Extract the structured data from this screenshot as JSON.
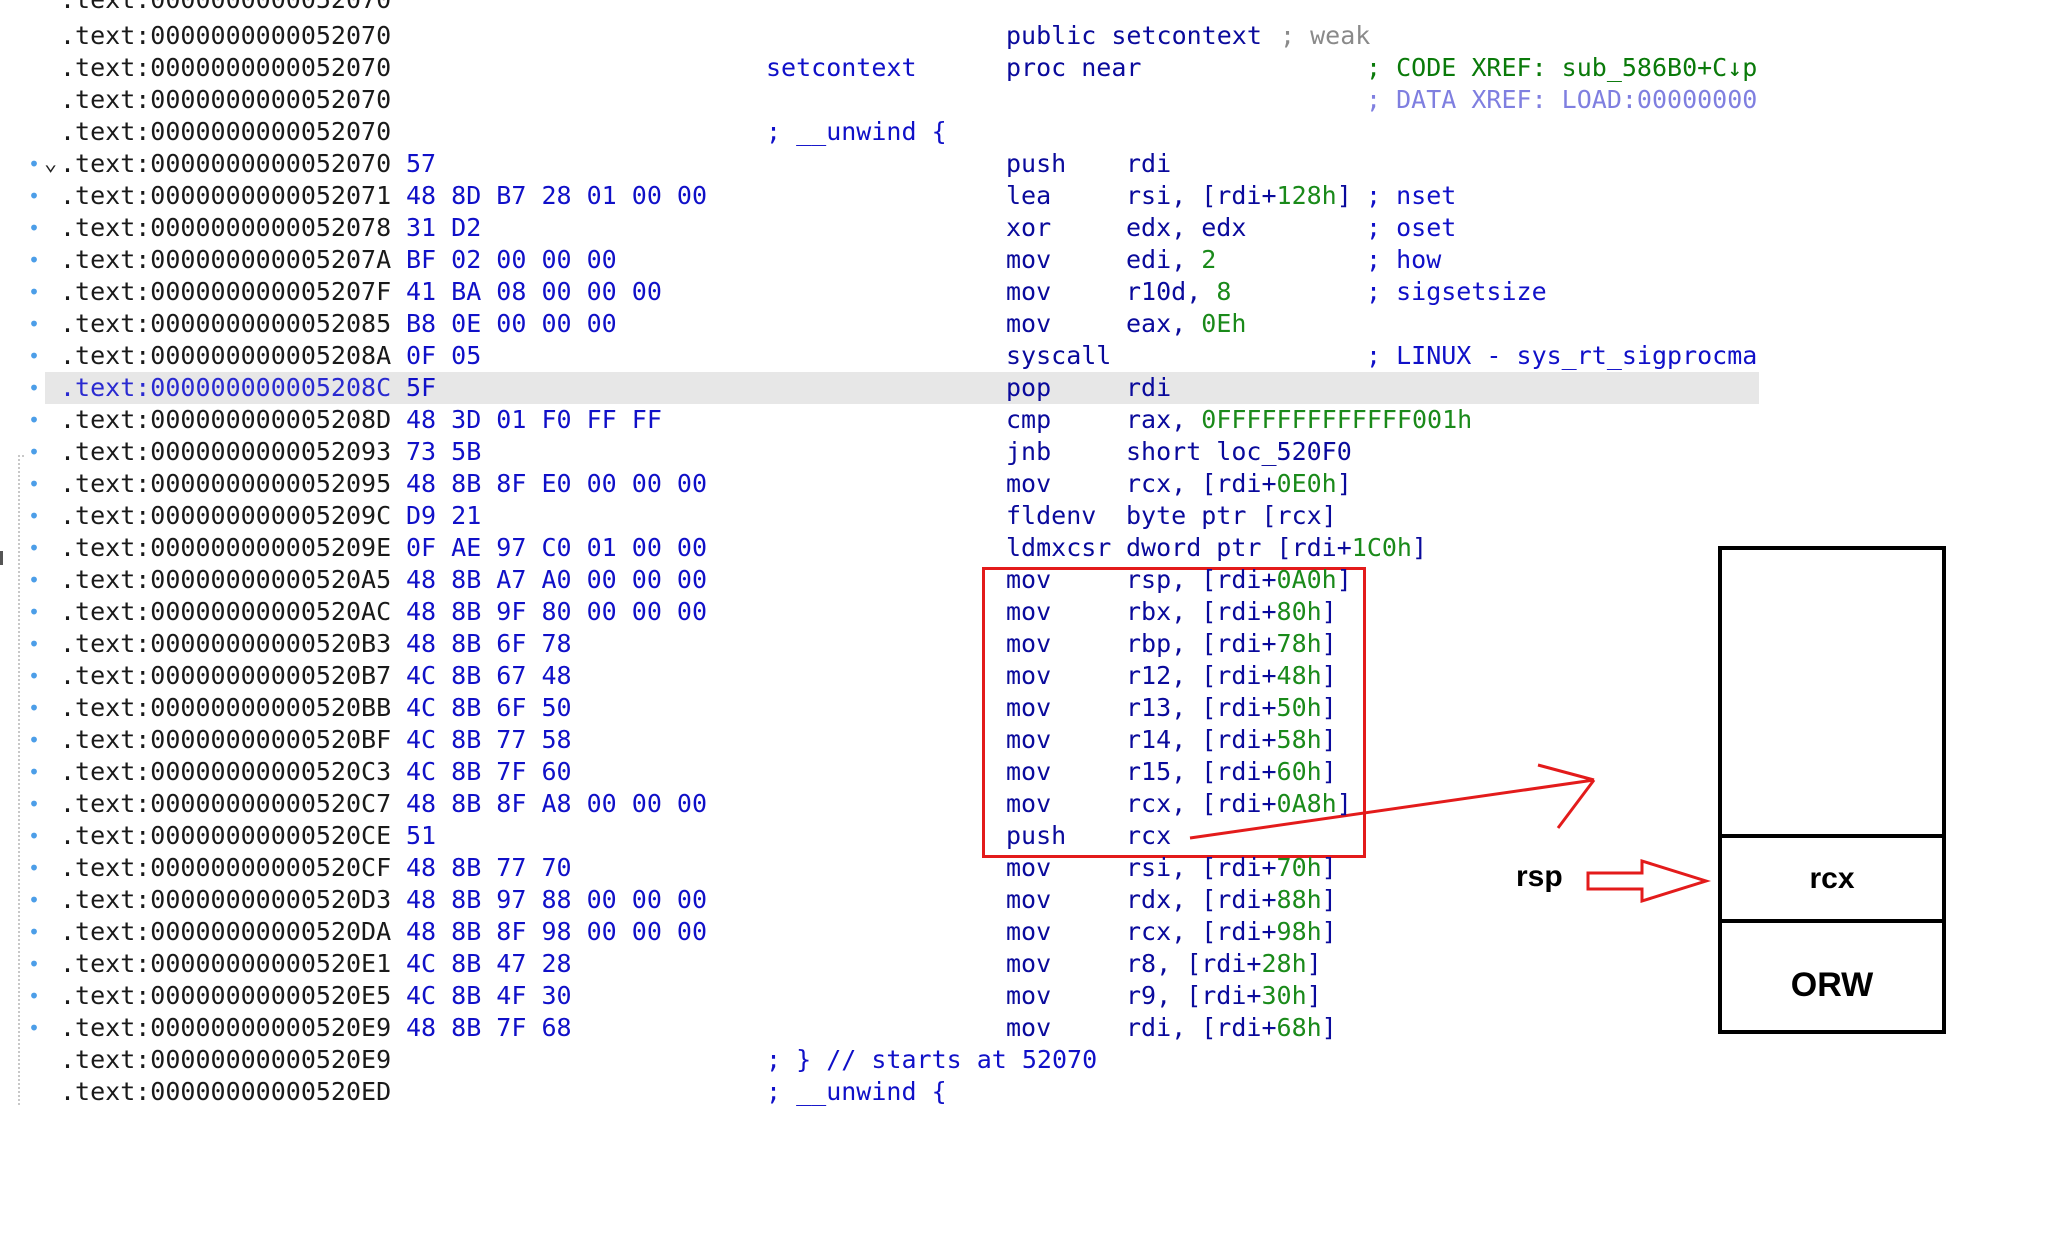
{
  "disassembly": {
    "rows": [
      {
        "addr": ".text:0000000000052070",
        "bytes": "",
        "label": "",
        "mnem": "",
        "ops": "",
        "comment": ""
      },
      {
        "addr": ".text:0000000000052070",
        "bytes": "",
        "label": "",
        "mnem": "public setcontext",
        "ops": "",
        "comment": "; weak"
      },
      {
        "addr": ".text:0000000000052070",
        "bytes": "",
        "label": "setcontext",
        "mnem": "proc near",
        "ops": "",
        "comment": "; CODE XREF: sub_586B0+C↓p"
      },
      {
        "addr": ".text:0000000000052070",
        "bytes": "",
        "label": "",
        "mnem": "",
        "ops": "",
        "comment": "; DATA XREF: LOAD:00000000"
      },
      {
        "addr": ".text:0000000000052070",
        "bytes": "",
        "label": "; __unwind {",
        "mnem": "",
        "ops": "",
        "comment": ""
      },
      {
        "addr": ".text:0000000000052070",
        "bytes": "57",
        "label": "",
        "mnem": "push",
        "ops": "rdi",
        "comment": ""
      },
      {
        "addr": ".text:0000000000052071",
        "bytes": "48 8D B7 28 01 00 00",
        "label": "",
        "mnem": "lea",
        "ops": "rsi, [rdi+128h]",
        "comment": "; nset"
      },
      {
        "addr": ".text:0000000000052078",
        "bytes": "31 D2",
        "label": "",
        "mnem": "xor",
        "ops": "edx, edx",
        "comment": "; oset"
      },
      {
        "addr": ".text:000000000005207A",
        "bytes": "BF 02 00 00 00",
        "label": "",
        "mnem": "mov",
        "ops": "edi, 2",
        "comment": "; how"
      },
      {
        "addr": ".text:000000000005207F",
        "bytes": "41 BA 08 00 00 00",
        "label": "",
        "mnem": "mov",
        "ops": "r10d, 8",
        "comment": "; sigsetsize"
      },
      {
        "addr": ".text:0000000000052085",
        "bytes": "B8 0E 00 00 00",
        "label": "",
        "mnem": "mov",
        "ops": "eax, 0Eh",
        "comment": ""
      },
      {
        "addr": ".text:000000000005208A",
        "bytes": "0F 05",
        "label": "",
        "mnem": "syscall",
        "ops": "",
        "comment": "; LINUX - sys_rt_sigprocma"
      },
      {
        "addr": ".text:000000000005208C",
        "bytes": "5F",
        "label": "",
        "mnem": "pop",
        "ops": "rdi",
        "comment": ""
      },
      {
        "addr": ".text:000000000005208D",
        "bytes": "48 3D 01 F0 FF FF",
        "label": "",
        "mnem": "cmp",
        "ops": "rax, 0FFFFFFFFFFFFF001h",
        "comment": ""
      },
      {
        "addr": ".text:0000000000052093",
        "bytes": "73 5B",
        "label": "",
        "mnem": "jnb",
        "ops": "short loc_520F0",
        "comment": ""
      },
      {
        "addr": ".text:0000000000052095",
        "bytes": "48 8B 8F E0 00 00 00",
        "label": "",
        "mnem": "mov",
        "ops": "rcx, [rdi+0E0h]",
        "comment": ""
      },
      {
        "addr": ".text:000000000005209C",
        "bytes": "D9 21",
        "label": "",
        "mnem": "fldenv",
        "ops": "byte ptr [rcx]",
        "comment": ""
      },
      {
        "addr": ".text:000000000005209E",
        "bytes": "0F AE 97 C0 01 00 00",
        "label": "",
        "mnem": "ldmxcsr",
        "ops": "dword ptr [rdi+1C0h]",
        "comment": ""
      },
      {
        "addr": ".text:00000000000520A5",
        "bytes": "48 8B A7 A0 00 00 00",
        "label": "",
        "mnem": "mov",
        "ops": "rsp, [rdi+0A0h]",
        "comment": ""
      },
      {
        "addr": ".text:00000000000520AC",
        "bytes": "48 8B 9F 80 00 00 00",
        "label": "",
        "mnem": "mov",
        "ops": "rbx, [rdi+80h]",
        "comment": ""
      },
      {
        "addr": ".text:00000000000520B3",
        "bytes": "48 8B 6F 78",
        "label": "",
        "mnem": "mov",
        "ops": "rbp, [rdi+78h]",
        "comment": ""
      },
      {
        "addr": ".text:00000000000520B7",
        "bytes": "4C 8B 67 48",
        "label": "",
        "mnem": "mov",
        "ops": "r12, [rdi+48h]",
        "comment": ""
      },
      {
        "addr": ".text:00000000000520BB",
        "bytes": "4C 8B 6F 50",
        "label": "",
        "mnem": "mov",
        "ops": "r13, [rdi+50h]",
        "comment": ""
      },
      {
        "addr": ".text:00000000000520BF",
        "bytes": "4C 8B 77 58",
        "label": "",
        "mnem": "mov",
        "ops": "r14, [rdi+58h]",
        "comment": ""
      },
      {
        "addr": ".text:00000000000520C3",
        "bytes": "4C 8B 7F 60",
        "label": "",
        "mnem": "mov",
        "ops": "r15, [rdi+60h]",
        "comment": ""
      },
      {
        "addr": ".text:00000000000520C7",
        "bytes": "48 8B 8F A8 00 00 00",
        "label": "",
        "mnem": "mov",
        "ops": "rcx, [rdi+0A8h]",
        "comment": ""
      },
      {
        "addr": ".text:00000000000520CE",
        "bytes": "51",
        "label": "",
        "mnem": "push",
        "ops": "rcx",
        "comment": ""
      },
      {
        "addr": ".text:00000000000520CF",
        "bytes": "48 8B 77 70",
        "label": "",
        "mnem": "mov",
        "ops": "rsi, [rdi+70h]",
        "comment": ""
      },
      {
        "addr": ".text:00000000000520D3",
        "bytes": "48 8B 97 88 00 00 00",
        "label": "",
        "mnem": "mov",
        "ops": "rdx, [rdi+88h]",
        "comment": ""
      },
      {
        "addr": ".text:00000000000520DA",
        "bytes": "48 8B 8F 98 00 00 00",
        "label": "",
        "mnem": "mov",
        "ops": "rcx, [rdi+98h]",
        "comment": ""
      },
      {
        "addr": ".text:00000000000520E1",
        "bytes": "4C 8B 47 28",
        "label": "",
        "mnem": "mov",
        "ops": "r8, [rdi+28h]",
        "comment": ""
      },
      {
        "addr": ".text:00000000000520E5",
        "bytes": "4C 8B 4F 30",
        "label": "",
        "mnem": "mov",
        "ops": "r9, [rdi+30h]",
        "comment": ""
      },
      {
        "addr": ".text:00000000000520E9",
        "bytes": "48 8B 7F 68",
        "label": "",
        "mnem": "mov",
        "ops": "rdi, [rdi+68h]",
        "comment": ""
      },
      {
        "addr": ".text:00000000000520E9",
        "bytes": "",
        "label": "; } // starts at 52070",
        "mnem": "",
        "ops": "",
        "comment": ""
      },
      {
        "addr": ".text:00000000000520ED",
        "bytes": "",
        "label": "; __unwind {",
        "mnem": "",
        "ops": "",
        "comment": ""
      }
    ]
  },
  "annotations": {
    "rsp_label": "rsp",
    "stack_slot_rcx": "rcx",
    "stack_slot_orw": "ORW",
    "highlight_color": "#e31b1b"
  }
}
